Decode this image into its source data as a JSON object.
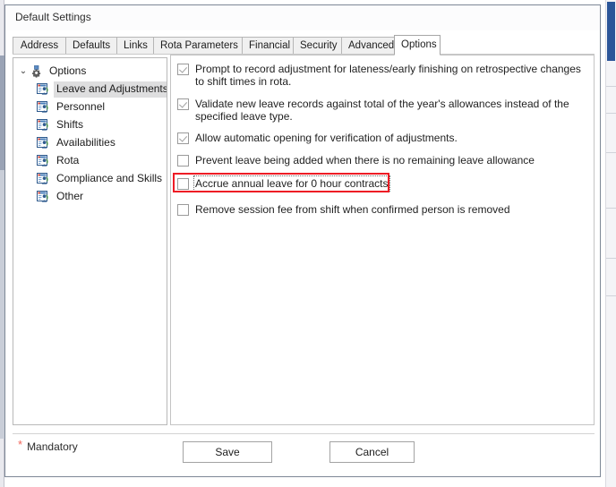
{
  "window": {
    "title": "Default Settings"
  },
  "tabs": [
    {
      "label": "Address",
      "active": false
    },
    {
      "label": "Defaults",
      "active": false
    },
    {
      "label": "Links",
      "active": false
    },
    {
      "label": "Rota Parameters",
      "active": false
    },
    {
      "label": "Financial",
      "active": false
    },
    {
      "label": "Security",
      "active": false
    },
    {
      "label": "Advanced",
      "active": false
    },
    {
      "label": "Options",
      "active": true
    }
  ],
  "tree": {
    "root": {
      "label": "Options",
      "icon": "gear-icon",
      "expanded": true,
      "chevron": "⌄"
    },
    "items": [
      {
        "label": "Leave and Adjustments",
        "icon": "form-person-icon",
        "selected": true
      },
      {
        "label": "Personnel",
        "icon": "form-person-icon",
        "selected": false
      },
      {
        "label": "Shifts",
        "icon": "form-person-icon",
        "selected": false
      },
      {
        "label": "Availabilities",
        "icon": "form-person-icon",
        "selected": false
      },
      {
        "label": "Rota",
        "icon": "form-person-icon",
        "selected": false
      },
      {
        "label": "Compliance and Skills",
        "icon": "form-person-icon",
        "selected": false
      },
      {
        "label": "Other",
        "icon": "form-person-icon",
        "selected": false
      }
    ]
  },
  "options": [
    {
      "label": "Prompt to record adjustment for lateness/early finishing on retrospective changes to shift times in rota.",
      "checked": true,
      "focused": false,
      "annotated": false
    },
    {
      "label": "Validate new leave records against total of the year's allowances instead of the specified leave type.",
      "checked": true,
      "focused": false,
      "annotated": false
    },
    {
      "label": "Allow automatic opening for verification of adjustments.",
      "checked": true,
      "focused": false,
      "annotated": false
    },
    {
      "label": "Prevent leave being added when there is no remaining leave allowance",
      "checked": false,
      "focused": false,
      "annotated": false
    },
    {
      "label": "Accrue annual leave for 0 hour contracts",
      "checked": false,
      "focused": true,
      "annotated": true
    },
    {
      "label": "Remove session fee from shift when confirmed person is removed",
      "checked": false,
      "focused": false,
      "annotated": false
    }
  ],
  "footer": {
    "mandatory_marker": "*",
    "mandatory_label": "Mandatory",
    "save_label": "Save",
    "cancel_label": "Cancel"
  },
  "colors": {
    "annotation_red": "#ee1c25",
    "mandatory_red": "#f2665c",
    "selection_gray": "#dededf",
    "scrollbar_thumb_blue": "#2c5699"
  }
}
